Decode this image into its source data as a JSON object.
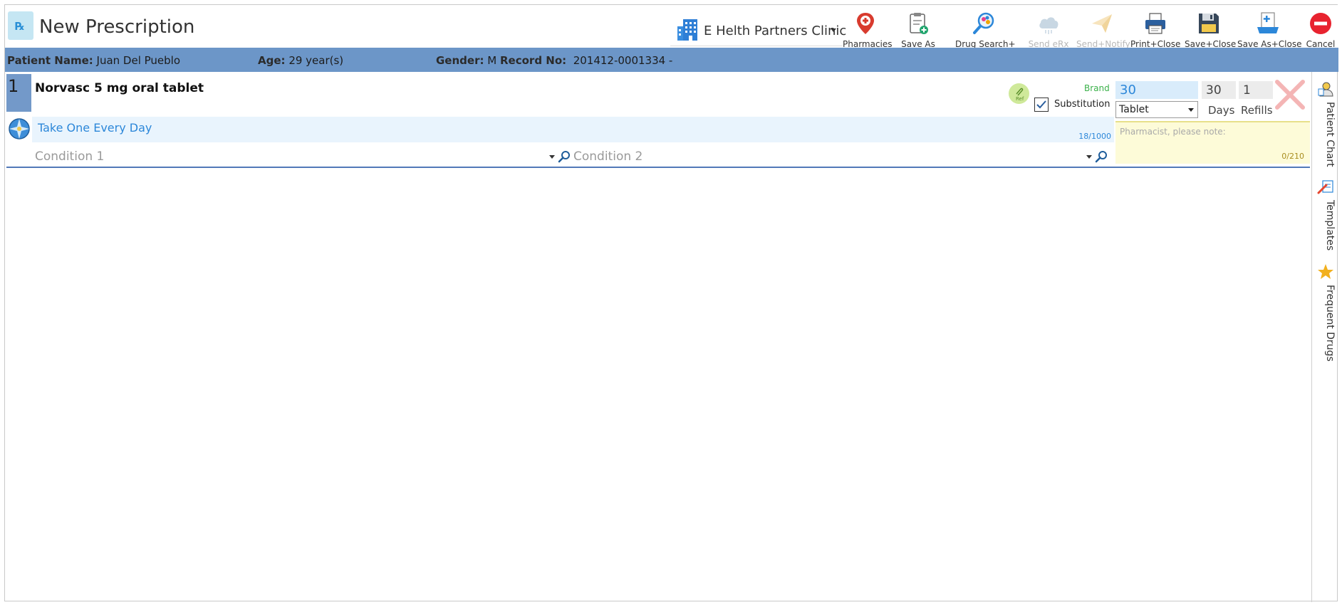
{
  "header": {
    "title": "New Prescription",
    "clinic": "E Helth Partners Clinic"
  },
  "toolbar": {
    "pharmacies": "Pharmacies",
    "save_as": "Save As",
    "drug_search": "Drug Search+",
    "send_erx": "Send eRx",
    "send_notify": "Send+Notify",
    "print_close": "Print+Close",
    "save_close": "Save+Close",
    "save_as_close": "Save As+Close",
    "cancel": "Cancel"
  },
  "patient": {
    "name_label": "Patient Name:",
    "name": "Juan Del Pueblo",
    "age_label": "Age:",
    "age": "29 year(s)",
    "gender_label": "Gender:",
    "gender": "M",
    "record_label": "Record No:",
    "record": "201412-0001334 -"
  },
  "prescription": {
    "number": "1",
    "drug": "Norvasc 5 mg oral tablet",
    "sig": "Take One Every Day",
    "sig_count": "18/1000",
    "condition1_placeholder": "Condition 1",
    "condition2_placeholder": "Condition 2",
    "ref_badge": "Ref",
    "brand_label": "Brand",
    "substitution_label": "Substitution",
    "substitution_checked": true,
    "quantity": "30",
    "form": "Tablet",
    "days": "30",
    "days_label": "Days",
    "refills": "1",
    "refills_label": "Refills",
    "note_placeholder": "Pharmacist, please note:",
    "note_count": "0/210"
  },
  "sidebar": {
    "patient_chart": "Patient Chart",
    "templates": "Templates",
    "frequent_drugs": "Frequent Drugs"
  },
  "colors": {
    "patient_band": "#6c96c8",
    "accent_blue": "#2c87d9",
    "brand_green": "#3bb14a",
    "cancel_red": "#e8232f"
  }
}
